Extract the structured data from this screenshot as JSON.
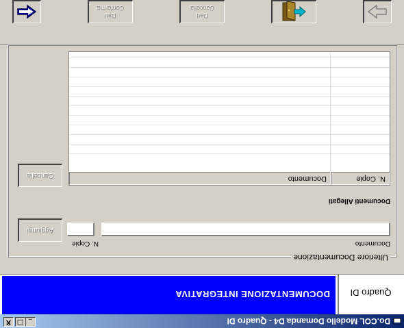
{
  "window": {
    "title": "Do.COL Modello Domanda D4 - Quadro DI",
    "controls": [
      "_",
      "□",
      "X"
    ]
  },
  "header": {
    "quadro_label": "Quadro DI",
    "section_title": "DOCUMENTAZIONE INTEGRATIVA",
    "band_color": "#0000ff"
  },
  "group": {
    "caption": "Ulteriore Documentazione",
    "documento_label": "Documento",
    "documento_value": "",
    "copie_label": "N. Copie",
    "copie_value": "",
    "add_button": "Aggiungi",
    "list_label": "Documenti Allegati",
    "delete_button": "Cancella",
    "grid": {
      "columns": [
        "Documento",
        "N. Copie"
      ],
      "rows": []
    }
  },
  "toolbar": {
    "back_icon": "left-arrow-icon",
    "confirm_label_1": "Dati",
    "confirm_label_2": "Conferma",
    "cancel_label_1": "Dati",
    "cancel_label_2": "Cancella",
    "exit_icon": "exit-door-icon",
    "forward_icon": "right-arrow-icon"
  }
}
